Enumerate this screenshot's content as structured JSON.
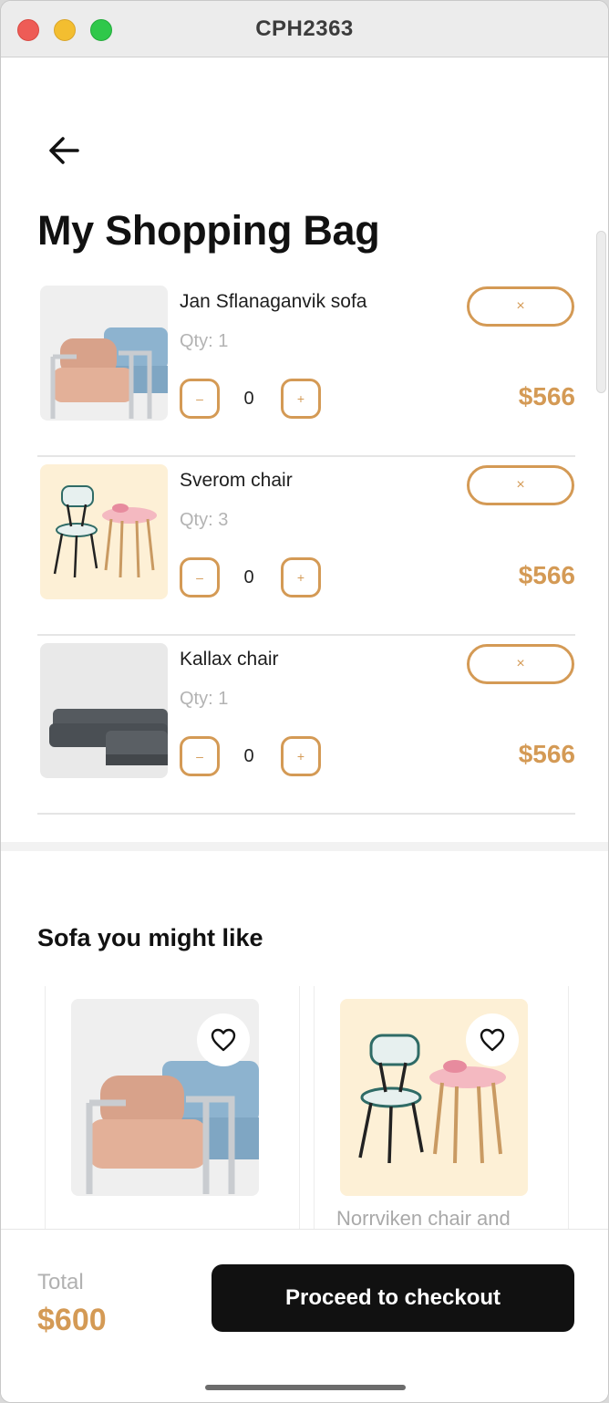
{
  "window": {
    "title": "CPH2363"
  },
  "header": {
    "title": "My Shopping Bag",
    "back_icon": "arrow-left-icon"
  },
  "cart": {
    "items": [
      {
        "name": "Jan Sflanaganvik sofa",
        "qty": "Qty: 1",
        "count": "0",
        "price": "$566",
        "minus": "–",
        "plus": "+",
        "remove": "×",
        "image": "pink-armchair"
      },
      {
        "name": "Sverom chair",
        "qty": "Qty: 3",
        "count": "0",
        "price": "$566",
        "minus": "–",
        "plus": "+",
        "remove": "×",
        "image": "patterned-chair-and-table"
      },
      {
        "name": "Kallax chair",
        "qty": "Qty: 1",
        "count": "0",
        "price": "$566",
        "minus": "–",
        "plus": "+",
        "remove": "×",
        "image": "grey-sectional-sofa"
      }
    ]
  },
  "recommendations": {
    "title": "Sofa you might like",
    "items": [
      {
        "name": "",
        "image": "pink-armchair",
        "favorite_icon": "heart-outline-icon"
      },
      {
        "name": "Norrviken chair and",
        "image": "patterned-chair-and-table",
        "favorite_icon": "heart-outline-icon"
      }
    ]
  },
  "footer": {
    "total_label": "Total",
    "total_value": "$600",
    "checkout_label": "Proceed to checkout"
  },
  "colors": {
    "accent": "#d49a55",
    "button_dark": "#111111",
    "muted_text": "#b1b1b1"
  }
}
